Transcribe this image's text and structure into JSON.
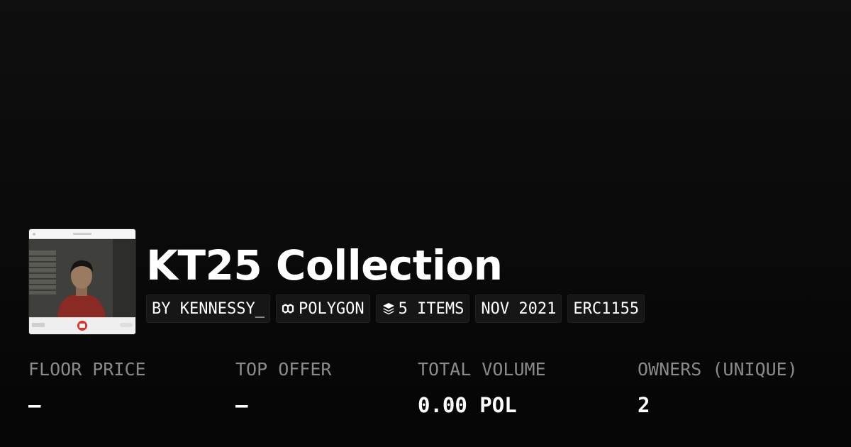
{
  "collection": {
    "title": "KT25 Collection",
    "badges": {
      "creator": "BY KENNESSY_",
      "chain": "POLYGON",
      "items": "5 ITEMS",
      "date": "NOV 2021",
      "standard": "ERC1155"
    },
    "icons": {
      "chain": "polygon-chain-icon",
      "items": "layers-icon"
    }
  },
  "stats": {
    "floor_price": {
      "label": "FLOOR PRICE",
      "value": "–"
    },
    "top_offer": {
      "label": "TOP OFFER",
      "value": "–"
    },
    "total_volume": {
      "label": "TOTAL VOLUME",
      "value": "0.00 POL"
    },
    "owners": {
      "label": "OWNERS (UNIQUE)",
      "value": "2"
    }
  },
  "colors": {
    "background": "#0a0a0a",
    "badge_bg": "#161616",
    "label_gray": "#8a8a8a",
    "text": "#ffffff",
    "camera_button": "#d9352b"
  }
}
